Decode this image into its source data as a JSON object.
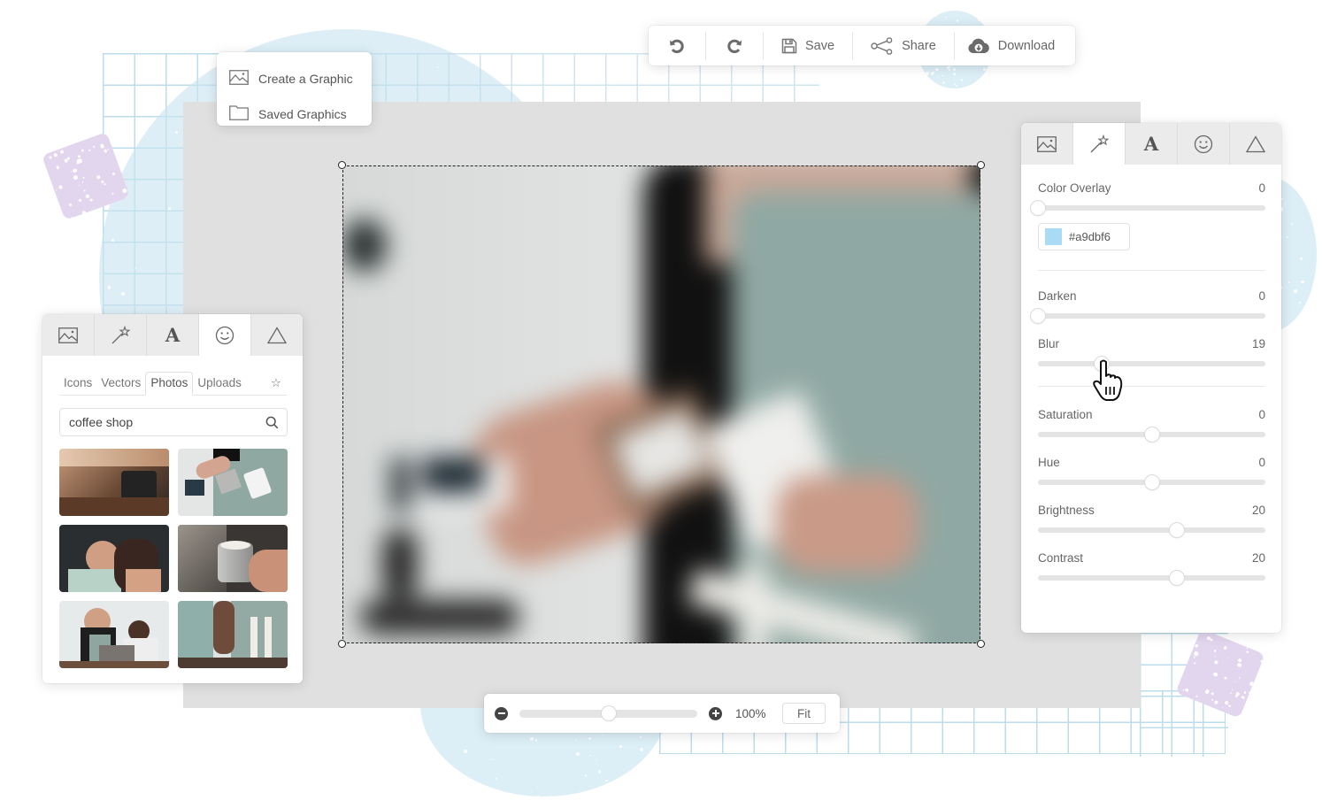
{
  "toolbar": {
    "undo_icon": "undo-icon",
    "redo_icon": "redo-icon",
    "save_label": "Save",
    "share_label": "Share",
    "download_label": "Download"
  },
  "file_menu": {
    "items": [
      {
        "label": "Create a Graphic",
        "icon": "image-icon"
      },
      {
        "label": "Saved Graphics",
        "icon": "folder-icon"
      }
    ]
  },
  "adjust_panel": {
    "tabs": [
      {
        "name": "images",
        "icon": "image-icon",
        "active": false
      },
      {
        "name": "effects",
        "icon": "magic-wand-icon",
        "active": true
      },
      {
        "name": "text",
        "icon": "text-icon",
        "glyph": "A",
        "active": false
      },
      {
        "name": "stickers",
        "icon": "smiley-icon",
        "active": false
      },
      {
        "name": "shapes",
        "icon": "triangle-icon",
        "active": false
      }
    ],
    "color_overlay": {
      "label": "Color Overlay",
      "value": "0",
      "fraction": 0.0,
      "color_hex": "#a9dbf6",
      "color_label": "#a9dbf6"
    },
    "sliders": [
      {
        "label": "Darken",
        "value": "0",
        "fraction": 0.0
      },
      {
        "label": "Blur",
        "value": "19",
        "fraction": 0.28
      },
      {
        "label": "Saturation",
        "value": "0",
        "fraction": 0.5
      },
      {
        "label": "Hue",
        "value": "0",
        "fraction": 0.5
      },
      {
        "label": "Brightness",
        "value": "20",
        "fraction": 0.61
      },
      {
        "label": "Contrast",
        "value": "20",
        "fraction": 0.61
      }
    ]
  },
  "library_panel": {
    "tabs": [
      {
        "name": "images",
        "icon": "image-icon",
        "active": false
      },
      {
        "name": "effects",
        "icon": "magic-wand-icon",
        "active": false
      },
      {
        "name": "text",
        "icon": "text-icon",
        "glyph": "A",
        "active": false
      },
      {
        "name": "stickers",
        "icon": "smiley-icon",
        "active": true
      },
      {
        "name": "shapes",
        "icon": "triangle-icon",
        "active": false
      }
    ],
    "subtabs": [
      {
        "label": "Icons",
        "active": false
      },
      {
        "label": "Vectors",
        "active": false
      },
      {
        "label": "Photos",
        "active": true
      },
      {
        "label": "Uploads",
        "active": false
      }
    ],
    "favorites_icon": "star-icon",
    "favorites_glyph": "☆",
    "search": {
      "value": "coffee shop",
      "placeholder": ""
    },
    "results": [
      {
        "alt": "espresso machines in coffee shop"
      },
      {
        "alt": "barista pouring milk into cup"
      },
      {
        "alt": "couple in a cafe"
      },
      {
        "alt": "steaming milk pitcher"
      },
      {
        "alt": "baristas at laptop"
      },
      {
        "alt": "barista tamping espresso"
      }
    ]
  },
  "canvas": {
    "image_alt": "blurred barista pouring milk into paper cup"
  },
  "zoom_bar": {
    "zoom_fraction": 0.5,
    "zoom_value": "100%",
    "fit_label": "Fit"
  },
  "colors": {
    "accent_light_blue": "#a9dbf6",
    "canvas_bg": "#e0e0e0",
    "decor_lavender": "#e2d6ee",
    "decor_blue": "#dceef6"
  }
}
